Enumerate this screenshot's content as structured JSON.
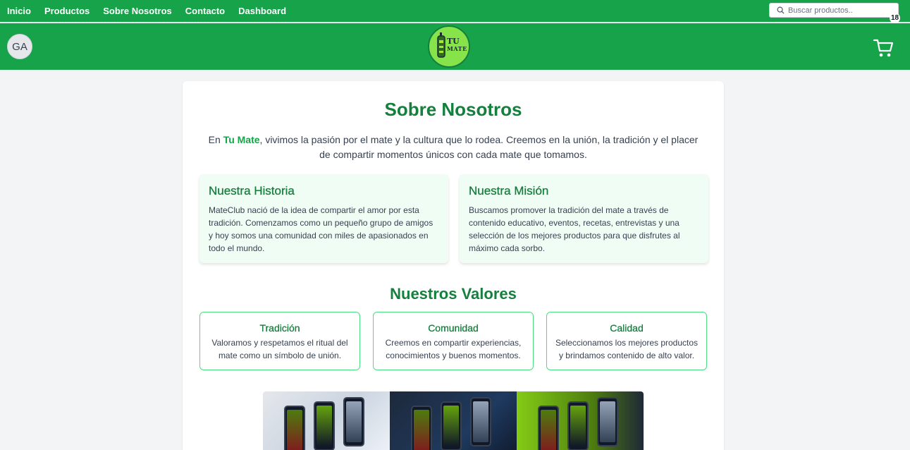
{
  "nav": {
    "links": [
      "Inicio",
      "Productos",
      "Sobre Nosotros",
      "Contacto",
      "Dashboard"
    ],
    "search_placeholder": "Buscar productos.."
  },
  "header": {
    "avatar_initials": "GA",
    "logo_line1": "TU",
    "logo_line2": "MATE",
    "cart_count": "18"
  },
  "about": {
    "title": "Sobre Nosotros",
    "intro_prefix": "En ",
    "intro_brand": "Tu Mate",
    "intro_rest": ", vivimos la pasión por el mate y la cultura que lo rodea. Creemos en la unión, la tradición y el placer de compartir momentos únicos con cada mate que tomamos.",
    "history": {
      "title": "Nuestra Historia",
      "text": "MateClub nació de la idea de compartir el amor por esta tradición. Comenzamos como un pequeño grupo de amigos y hoy somos una comunidad con miles de apasionados en todo el mundo."
    },
    "mission": {
      "title": "Nuestra Misión",
      "text": "Buscamos promover la tradición del mate a través de contenido educativo, eventos, recetas, entrevistas y una selección de los mejores productos para que disfrutes al máximo cada sorbo."
    },
    "values_title": "Nuestros Valores",
    "values": [
      {
        "title": "Tradición",
        "text": "Valoramos y respetamos el ritual del mate como un símbolo de unión."
      },
      {
        "title": "Comunidad",
        "text": "Creemos en compartir experiencias, conocimientos y buenos momentos."
      },
      {
        "title": "Calidad",
        "text": "Seleccionamos los mejores productos y brindamos contenido de alto valor."
      }
    ]
  },
  "colors": {
    "brand_green": "#16a34a",
    "title_green": "#15803d",
    "card_tint": "#f0fdf4",
    "value_border": "#4ade80"
  }
}
